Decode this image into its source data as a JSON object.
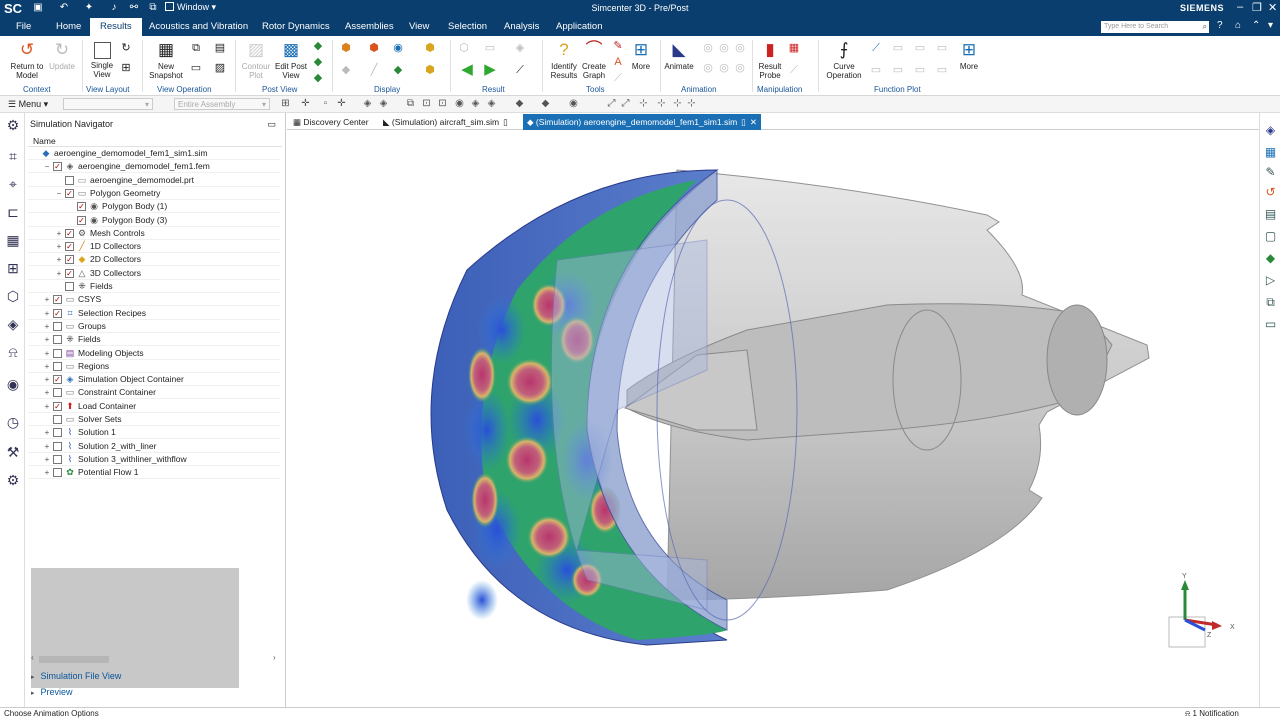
{
  "titlebar": {
    "app_short": "SC",
    "window_label": "Window",
    "title": "Simcenter 3D - Pre/Post",
    "brand": "SIEMENS"
  },
  "menubar": {
    "items": [
      "File",
      "Home",
      "Results",
      "Acoustics and Vibration",
      "Rotor Dynamics",
      "Assemblies",
      "View",
      "Selection",
      "Analysis",
      "Application"
    ],
    "active": "Results",
    "search_placeholder": "Type Here to Search"
  },
  "ribbon": {
    "buttons": {
      "return_to_model": "Return to\nModel",
      "update": "Update",
      "single_view": "Single\nView",
      "new_snapshot": "New\nSnapshot",
      "contour_plot": "Contour\nPlot",
      "edit_post_view": "Edit Post\nView",
      "identify_results": "Identify\nResults",
      "create_graph": "Create\nGraph",
      "more_tools": "More",
      "animate": "Animate",
      "result_probe": "Result\nProbe",
      "curve_operation": "Curve\nOperation",
      "more_function": "More"
    },
    "groups": [
      "Context",
      "View Layout",
      "View Operation",
      "Post View",
      "Display",
      "Result",
      "Tools",
      "Animation",
      "Manipulation",
      "Function Plot"
    ]
  },
  "toolbar2": {
    "menu_label": "Menu",
    "filter_value": "",
    "assembly_placeholder": "Entire Assembly"
  },
  "navigator": {
    "title": "Simulation Navigator",
    "column": "Name",
    "tree": [
      {
        "label": "aeroengine_demomodel_fem1_sim1.sim",
        "indent": 0,
        "expander": "",
        "checked": false,
        "icon": "sim",
        "bold": false
      },
      {
        "label": "aeroengine_demomodel_fem1.fem",
        "indent": 1,
        "expander": "−",
        "checked": true,
        "icon": "fem"
      },
      {
        "label": "aeroengine_demomodel.prt",
        "indent": 2,
        "expander": "",
        "checked": false,
        "icon": "prt"
      },
      {
        "label": "Polygon Geometry",
        "indent": 2,
        "expander": "−",
        "checked": true,
        "icon": "folder"
      },
      {
        "label": "Polygon Body (1)",
        "indent": 3,
        "expander": "",
        "checked": true,
        "icon": "body"
      },
      {
        "label": "Polygon Body (3)",
        "indent": 3,
        "expander": "",
        "checked": true,
        "icon": "body"
      },
      {
        "label": "Mesh Controls",
        "indent": 2,
        "expander": "+",
        "checked": true,
        "icon": "mesh"
      },
      {
        "label": "1D Collectors",
        "indent": 2,
        "expander": "+",
        "checked": true,
        "icon": "c1d"
      },
      {
        "label": "2D Collectors",
        "indent": 2,
        "expander": "+",
        "checked": true,
        "icon": "c2d"
      },
      {
        "label": "3D Collectors",
        "indent": 2,
        "expander": "+",
        "checked": true,
        "icon": "c3d"
      },
      {
        "label": "Fields",
        "indent": 2,
        "expander": "",
        "checked": false,
        "icon": "fields"
      },
      {
        "label": "CSYS",
        "indent": 1,
        "expander": "+",
        "checked": true,
        "icon": "folder"
      },
      {
        "label": "Selection Recipes",
        "indent": 1,
        "expander": "+",
        "checked": true,
        "icon": "recipe"
      },
      {
        "label": "Groups",
        "indent": 1,
        "expander": "+",
        "checked": false,
        "icon": "folder"
      },
      {
        "label": "Fields",
        "indent": 1,
        "expander": "+",
        "checked": false,
        "icon": "fields"
      },
      {
        "label": "Modeling Objects",
        "indent": 1,
        "expander": "+",
        "checked": false,
        "icon": "model"
      },
      {
        "label": "Regions",
        "indent": 1,
        "expander": "+",
        "checked": false,
        "icon": "folder"
      },
      {
        "label": "Simulation Object Container",
        "indent": 1,
        "expander": "+",
        "checked": true,
        "icon": "container"
      },
      {
        "label": "Constraint Container",
        "indent": 1,
        "expander": "+",
        "checked": false,
        "icon": "folder"
      },
      {
        "label": "Load Container",
        "indent": 1,
        "expander": "+",
        "checked": true,
        "icon": "load"
      },
      {
        "label": "Solver Sets",
        "indent": 1,
        "expander": "",
        "checked": false,
        "icon": "folder"
      },
      {
        "label": "Solution 1",
        "indent": 1,
        "expander": "+",
        "checked": false,
        "icon": "solution"
      },
      {
        "label": "Solution 2_with_liner",
        "indent": 1,
        "expander": "+",
        "checked": false,
        "icon": "solution"
      },
      {
        "label": "Solution 3_withliner_withflow",
        "indent": 1,
        "expander": "+",
        "checked": false,
        "icon": "solution"
      },
      {
        "label": "Potential Flow 1",
        "indent": 1,
        "expander": "+",
        "checked": false,
        "icon": "flow"
      }
    ],
    "sections": [
      "Simulation File View",
      "Preview"
    ]
  },
  "tabs": [
    {
      "label": "Discovery Center",
      "active": false
    },
    {
      "label": "(Simulation) aircraft_sim.sim",
      "active": false
    },
    {
      "label": "(Simulation) aeroengine_demomodel_fem1_sim1.sim",
      "active": true
    }
  ],
  "triad": {
    "x": "X",
    "y": "Y",
    "z": "Z"
  },
  "status": {
    "left": "Choose Animation Options",
    "right": "1 Notification"
  },
  "colors": {
    "chrome": "#0a3e6e",
    "accent": "#1a6fb5",
    "contour_high": "#b8356d",
    "contour_low": "#2a4fd8",
    "contour_mid": "#2ea36b"
  }
}
